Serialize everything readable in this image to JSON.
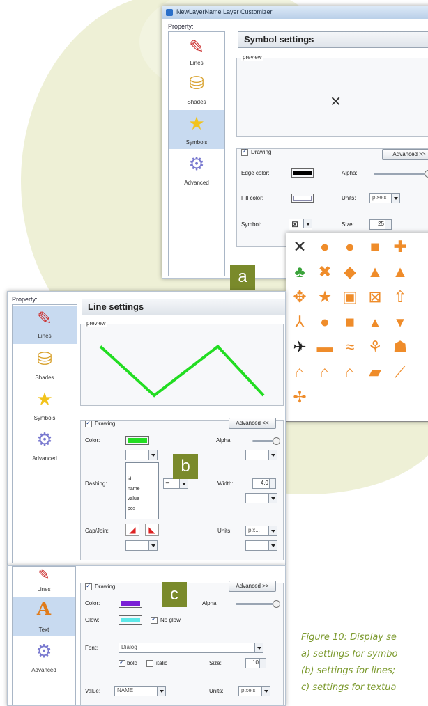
{
  "colors": {
    "accent_olive": "#7a8a2b",
    "bg_leaf": "#eef0d6",
    "line_green": "#22dd22",
    "symbol_orange": "#ef8c2a",
    "caption_green": "#7c9a2e"
  },
  "panel_a": {
    "window_title": "NewLayerName Layer Customizer",
    "property_label": "Property:",
    "sidebar": [
      {
        "label": "Lines",
        "icon": "pencil-icon"
      },
      {
        "label": "Shades",
        "icon": "paint-bucket-icon"
      },
      {
        "label": "Symbols",
        "icon": "star-icon"
      },
      {
        "label": "Advanced",
        "icon": "gears-icon"
      }
    ],
    "header": "Symbol settings",
    "preview_label": "preview",
    "preview_symbol": "×",
    "drawing_label": "Drawing",
    "advanced_button": "Advanced >>",
    "edge_color_label": "Edge color:",
    "alpha_label": "Alpha:",
    "fill_color_label": "Fill color:",
    "units_label": "Units:",
    "units_value": "pixels",
    "symbol_label": "Symbol:",
    "symbol_value": "⊠",
    "size_label": "Size:",
    "size_value": "25"
  },
  "palette_symbols": [
    "✕",
    "●",
    "●",
    "■",
    "✚",
    "♣",
    "✖",
    "◆",
    "▲",
    "▲",
    "✥",
    "★",
    "▣",
    "⊠",
    "⇧",
    "⅄",
    "●",
    "■",
    "▴",
    "▾",
    "✈",
    "▬",
    "≈",
    "⚘",
    "☗",
    "⌂",
    "⌂",
    "⌂",
    "▰",
    "⟋",
    "✢"
  ],
  "badges": {
    "a": "a",
    "b": "b",
    "c": "c"
  },
  "panel_b": {
    "property_label": "Property:",
    "sidebar": [
      {
        "label": "Lines",
        "icon": "pencil-icon"
      },
      {
        "label": "Shades",
        "icon": "paint-bucket-icon"
      },
      {
        "label": "Symbols",
        "icon": "star-icon"
      },
      {
        "label": "Advanced",
        "icon": "gears-icon"
      }
    ],
    "header": "Line settings",
    "preview_label": "preview",
    "drawing_label": "Drawing",
    "advanced_button": "Advanced <<",
    "color_label": "Color:",
    "alpha_label": "Alpha:",
    "dashing_label": "Dashing:",
    "width_label": "Width:",
    "width_value": "4.0",
    "cap_join_label": "Cap/Join:",
    "units_label": "Units:",
    "units_value": "pix...",
    "dropdown_options": [
      "",
      "id",
      "name",
      "value",
      "pos"
    ],
    "line_points": [
      [
        0,
        0.2
      ],
      [
        0.33,
        1.0
      ],
      [
        0.72,
        0.2
      ],
      [
        1.0,
        1.0
      ]
    ]
  },
  "panel_c": {
    "sidebar": [
      {
        "label": "Lines",
        "icon": "pencil-icon"
      },
      {
        "label": "Text",
        "icon": "text-a-icon"
      },
      {
        "label": "Advanced",
        "icon": "gears-icon"
      }
    ],
    "drawing_label": "Drawing",
    "advanced_button": "Advanced >>",
    "color_label": "Color:",
    "alpha_label": "Alpha:",
    "glow_label": "Glow:",
    "no_glow_label": "No glow",
    "font_label": "Font:",
    "font_value": "Dialog",
    "bold_label": "bold",
    "italic_label": "italic",
    "size_label": "Size:",
    "size_value": "10",
    "value_label": "Value:",
    "value_value": "NAME",
    "units_label": "Units:",
    "units_value": "pixels"
  },
  "caption": {
    "line1": "Figure 10:  Display se",
    "line2": "a) settings for symbo",
    "line3": "(b) settings for lines;",
    "line4": "c) settings for textua"
  }
}
